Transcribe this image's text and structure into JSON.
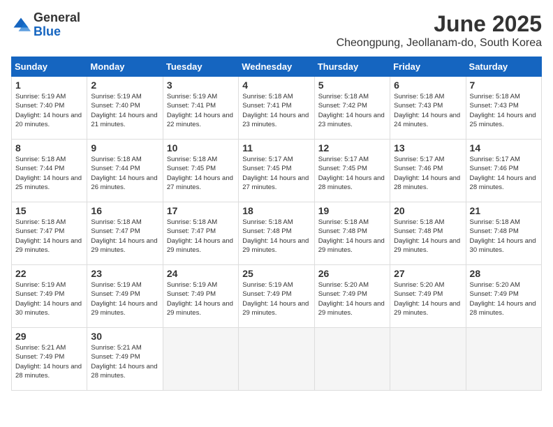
{
  "logo": {
    "general": "General",
    "blue": "Blue"
  },
  "header": {
    "month": "June 2025",
    "location": "Cheongpung, Jeollanam-do, South Korea"
  },
  "weekdays": [
    "Sunday",
    "Monday",
    "Tuesday",
    "Wednesday",
    "Thursday",
    "Friday",
    "Saturday"
  ],
  "weeks": [
    [
      {
        "day": "1",
        "sunrise": "5:19 AM",
        "sunset": "7:40 PM",
        "daylight": "14 hours and 20 minutes."
      },
      {
        "day": "2",
        "sunrise": "5:19 AM",
        "sunset": "7:40 PM",
        "daylight": "14 hours and 21 minutes."
      },
      {
        "day": "3",
        "sunrise": "5:19 AM",
        "sunset": "7:41 PM",
        "daylight": "14 hours and 22 minutes."
      },
      {
        "day": "4",
        "sunrise": "5:18 AM",
        "sunset": "7:41 PM",
        "daylight": "14 hours and 23 minutes."
      },
      {
        "day": "5",
        "sunrise": "5:18 AM",
        "sunset": "7:42 PM",
        "daylight": "14 hours and 23 minutes."
      },
      {
        "day": "6",
        "sunrise": "5:18 AM",
        "sunset": "7:43 PM",
        "daylight": "14 hours and 24 minutes."
      },
      {
        "day": "7",
        "sunrise": "5:18 AM",
        "sunset": "7:43 PM",
        "daylight": "14 hours and 25 minutes."
      }
    ],
    [
      {
        "day": "8",
        "sunrise": "5:18 AM",
        "sunset": "7:44 PM",
        "daylight": "14 hours and 25 minutes."
      },
      {
        "day": "9",
        "sunrise": "5:18 AM",
        "sunset": "7:44 PM",
        "daylight": "14 hours and 26 minutes."
      },
      {
        "day": "10",
        "sunrise": "5:18 AM",
        "sunset": "7:45 PM",
        "daylight": "14 hours and 27 minutes."
      },
      {
        "day": "11",
        "sunrise": "5:17 AM",
        "sunset": "7:45 PM",
        "daylight": "14 hours and 27 minutes."
      },
      {
        "day": "12",
        "sunrise": "5:17 AM",
        "sunset": "7:45 PM",
        "daylight": "14 hours and 28 minutes."
      },
      {
        "day": "13",
        "sunrise": "5:17 AM",
        "sunset": "7:46 PM",
        "daylight": "14 hours and 28 minutes."
      },
      {
        "day": "14",
        "sunrise": "5:17 AM",
        "sunset": "7:46 PM",
        "daylight": "14 hours and 28 minutes."
      }
    ],
    [
      {
        "day": "15",
        "sunrise": "5:18 AM",
        "sunset": "7:47 PM",
        "daylight": "14 hours and 29 minutes."
      },
      {
        "day": "16",
        "sunrise": "5:18 AM",
        "sunset": "7:47 PM",
        "daylight": "14 hours and 29 minutes."
      },
      {
        "day": "17",
        "sunrise": "5:18 AM",
        "sunset": "7:47 PM",
        "daylight": "14 hours and 29 minutes."
      },
      {
        "day": "18",
        "sunrise": "5:18 AM",
        "sunset": "7:48 PM",
        "daylight": "14 hours and 29 minutes."
      },
      {
        "day": "19",
        "sunrise": "5:18 AM",
        "sunset": "7:48 PM",
        "daylight": "14 hours and 29 minutes."
      },
      {
        "day": "20",
        "sunrise": "5:18 AM",
        "sunset": "7:48 PM",
        "daylight": "14 hours and 29 minutes."
      },
      {
        "day": "21",
        "sunrise": "5:18 AM",
        "sunset": "7:48 PM",
        "daylight": "14 hours and 30 minutes."
      }
    ],
    [
      {
        "day": "22",
        "sunrise": "5:19 AM",
        "sunset": "7:49 PM",
        "daylight": "14 hours and 30 minutes."
      },
      {
        "day": "23",
        "sunrise": "5:19 AM",
        "sunset": "7:49 PM",
        "daylight": "14 hours and 29 minutes."
      },
      {
        "day": "24",
        "sunrise": "5:19 AM",
        "sunset": "7:49 PM",
        "daylight": "14 hours and 29 minutes."
      },
      {
        "day": "25",
        "sunrise": "5:19 AM",
        "sunset": "7:49 PM",
        "daylight": "14 hours and 29 minutes."
      },
      {
        "day": "26",
        "sunrise": "5:20 AM",
        "sunset": "7:49 PM",
        "daylight": "14 hours and 29 minutes."
      },
      {
        "day": "27",
        "sunrise": "5:20 AM",
        "sunset": "7:49 PM",
        "daylight": "14 hours and 29 minutes."
      },
      {
        "day": "28",
        "sunrise": "5:20 AM",
        "sunset": "7:49 PM",
        "daylight": "14 hours and 28 minutes."
      }
    ],
    [
      {
        "day": "29",
        "sunrise": "5:21 AM",
        "sunset": "7:49 PM",
        "daylight": "14 hours and 28 minutes."
      },
      {
        "day": "30",
        "sunrise": "5:21 AM",
        "sunset": "7:49 PM",
        "daylight": "14 hours and 28 minutes."
      },
      null,
      null,
      null,
      null,
      null
    ]
  ]
}
